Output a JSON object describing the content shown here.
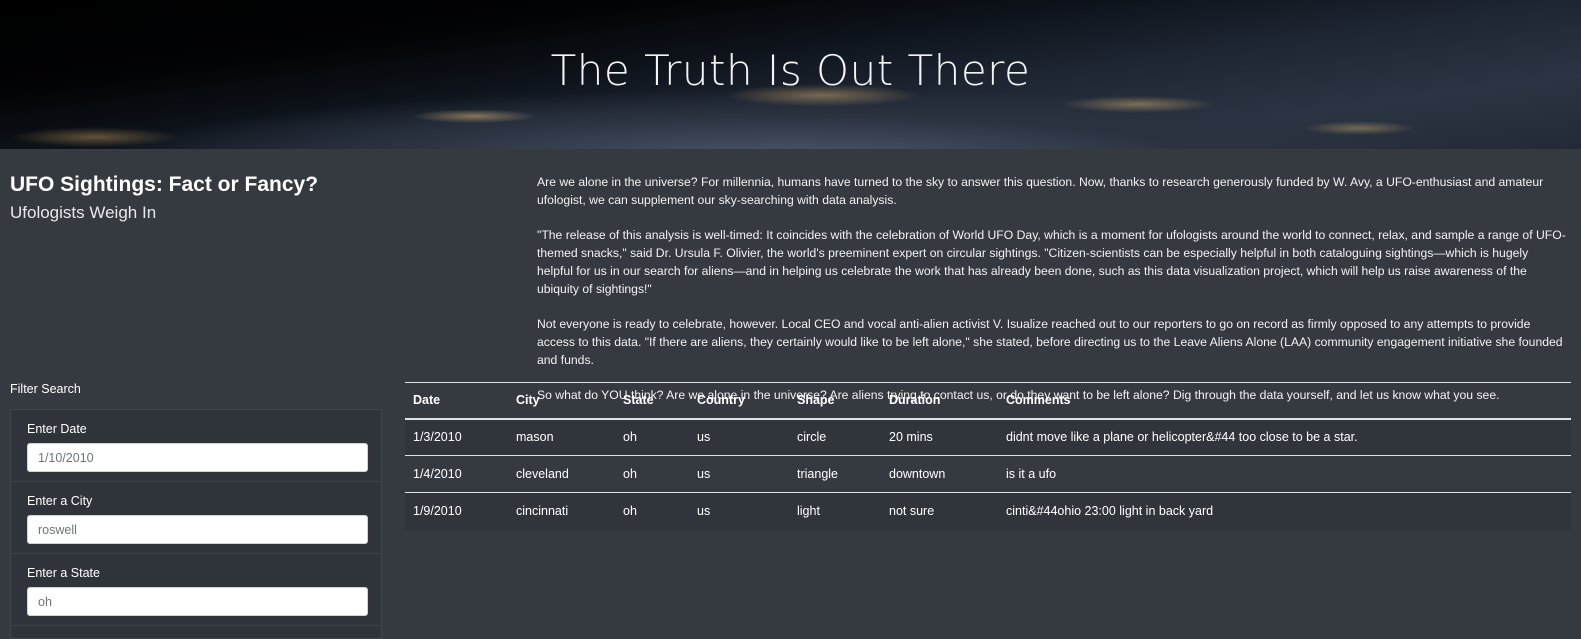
{
  "hero": {
    "title": "The Truth Is Out There"
  },
  "header": {
    "title": "UFO Sightings: Fact or Fancy?",
    "subtitle": "Ufologists Weigh In"
  },
  "article": {
    "paragraphs": [
      "Are we alone in the universe? For millennia, humans have turned to the sky to answer this question. Now, thanks to research generously funded by W. Avy, a UFO-enthusiast and amateur ufologist, we can supplement our sky-searching with data analysis.",
      "\"The release of this analysis is well-timed: It coincides with the celebration of World UFO Day, which is a moment for ufologists around the world to connect, relax, and sample a range of UFO-themed snacks,\" said Dr. Ursula F. Olivier, the world's preeminent expert on circular sightings. \"Citizen-scientists can be especially helpful in both cataloguing sightings—which is hugely helpful for us in our search for aliens—and in helping us celebrate the work that has already been done, such as this data visualization project, which will help us raise awareness of the ubiquity of sightings!\"",
      "Not everyone is ready to celebrate, however. Local CEO and vocal anti-alien activist V. Isualize reached out to our reporters to go on record as firmly opposed to any attempts to provide access to this data. \"If there are aliens, they certainly would like to be left alone,\" she stated, before directing us to the Leave Aliens Alone (LAA) community engagement initiative she founded and funds.",
      "So what do YOU think? Are we alone in the universe? Are aliens trying to contact us, or do they want to be left alone? Dig through the data yourself, and let us know what you see."
    ]
  },
  "filters": {
    "title": "Filter Search",
    "items": [
      {
        "label": "Enter Date",
        "placeholder": "1/10/2010"
      },
      {
        "label": "Enter a City",
        "placeholder": "roswell"
      },
      {
        "label": "Enter a State",
        "placeholder": "oh"
      }
    ]
  },
  "table": {
    "columns": [
      "Date",
      "City",
      "State",
      "Country",
      "Shape",
      "Duration",
      "Comments"
    ],
    "rows": [
      [
        "1/3/2010",
        "mason",
        "oh",
        "us",
        "circle",
        "20 mins",
        "didnt move like a plane or helicopter&#44 too close to be a star."
      ],
      [
        "1/4/2010",
        "cleveland",
        "oh",
        "us",
        "triangle",
        "downtown",
        "is it a ufo"
      ],
      [
        "1/9/2010",
        "cincinnati",
        "oh",
        "us",
        "light",
        "not sure",
        "cinti&#44ohio 23:00 light in back yard"
      ]
    ]
  }
}
